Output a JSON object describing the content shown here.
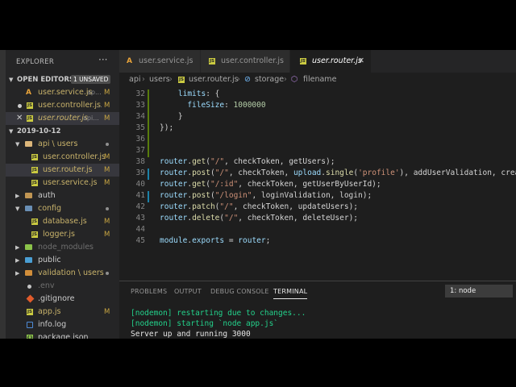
{
  "explorer": {
    "title": "EXPLORER",
    "more": "···",
    "open_editors": {
      "header": "OPEN EDITORS",
      "badge": "1 UNSAVED"
    },
    "open_files": [
      {
        "name": "user.service.js",
        "desc": "ap...",
        "status": "M"
      },
      {
        "name": "user.controller.js",
        "desc": "...",
        "status": "M"
      },
      {
        "name": "user.router.js",
        "desc": "api...",
        "status": "M",
        "close": "✕"
      }
    ],
    "project": {
      "name": "2019-10-12"
    },
    "tree": [
      {
        "name": "api \\ users"
      },
      {
        "name": "user.controller.js",
        "status": "M"
      },
      {
        "name": "user.router.js",
        "status": "M"
      },
      {
        "name": "user.service.js",
        "status": "M"
      },
      {
        "name": "auth"
      },
      {
        "name": "config"
      },
      {
        "name": "database.js",
        "status": "M"
      },
      {
        "name": "logger.js",
        "status": "M"
      },
      {
        "name": "node_modules"
      },
      {
        "name": "public"
      },
      {
        "name": "validation \\ users"
      },
      {
        "name": ".env"
      },
      {
        "name": ".gitignore"
      },
      {
        "name": "app.js",
        "status": "M"
      },
      {
        "name": "info.log"
      },
      {
        "name": "package.json"
      }
    ]
  },
  "tabs": [
    {
      "label": "user.service.js"
    },
    {
      "label": "user.controller.js"
    },
    {
      "label": "user.router.js",
      "close": "✕"
    }
  ],
  "breadcrumbs": [
    "api",
    "users",
    "user.router.js",
    "storage",
    "filename"
  ],
  "code": {
    "line_numbers": [
      "32",
      "33",
      "34",
      "35",
      "36",
      "37",
      "38",
      "39",
      "40",
      "41",
      "42",
      "43",
      "44",
      "45"
    ],
    "lines": [
      {
        "t": [
          [
            "kw",
            "    limits"
          ],
          [
            "pl",
            ": {"
          ]
        ]
      },
      {
        "t": [
          [
            "kw",
            "      fileSize"
          ],
          [
            "pl",
            ": "
          ],
          [
            "num",
            "1000000"
          ]
        ]
      },
      {
        "t": [
          [
            "pl",
            "    }"
          ]
        ]
      },
      {
        "t": [
          [
            "pl",
            "});"
          ]
        ]
      },
      {
        "t": []
      },
      {
        "t": []
      },
      {
        "t": [
          [
            "id",
            "router"
          ],
          [
            "pl",
            "."
          ],
          [
            "fn",
            "get"
          ],
          [
            "pl",
            "("
          ],
          [
            "str",
            "\"/\""
          ],
          [
            "pl",
            ", checkToken, getUsers);"
          ]
        ]
      },
      {
        "t": [
          [
            "id",
            "router"
          ],
          [
            "pl",
            "."
          ],
          [
            "fn",
            "post"
          ],
          [
            "pl",
            "("
          ],
          [
            "str",
            "\"/\""
          ],
          [
            "pl",
            ", checkToken, "
          ],
          [
            "id",
            "upload"
          ],
          [
            "pl",
            "."
          ],
          [
            "fn",
            "single"
          ],
          [
            "pl",
            "("
          ],
          [
            "str",
            "'profile'"
          ],
          [
            "pl",
            "), addUserValidation, crea"
          ]
        ]
      },
      {
        "t": [
          [
            "id",
            "router"
          ],
          [
            "pl",
            "."
          ],
          [
            "fn",
            "get"
          ],
          [
            "pl",
            "("
          ],
          [
            "str",
            "\"/:id\""
          ],
          [
            "pl",
            ", checkToken, getUserByUserId);"
          ]
        ]
      },
      {
        "t": [
          [
            "id",
            "router"
          ],
          [
            "pl",
            "."
          ],
          [
            "fn",
            "post"
          ],
          [
            "pl",
            "("
          ],
          [
            "str",
            "\"/login\""
          ],
          [
            "pl",
            ", loginValidation, login);"
          ]
        ]
      },
      {
        "t": [
          [
            "id",
            "router"
          ],
          [
            "pl",
            "."
          ],
          [
            "fn",
            "patch"
          ],
          [
            "pl",
            "("
          ],
          [
            "str",
            "\"/\""
          ],
          [
            "pl",
            ", checkToken, updateUsers);"
          ]
        ]
      },
      {
        "t": [
          [
            "id",
            "router"
          ],
          [
            "pl",
            "."
          ],
          [
            "fn",
            "delete"
          ],
          [
            "pl",
            "("
          ],
          [
            "str",
            "\"/\""
          ],
          [
            "pl",
            ", checkToken, deleteUser);"
          ]
        ]
      },
      {
        "t": []
      },
      {
        "t": [
          [
            "id",
            "module"
          ],
          [
            "pl",
            "."
          ],
          [
            "id",
            "exports"
          ],
          [
            "pl",
            " = "
          ],
          [
            "id",
            "router"
          ],
          [
            "pl",
            ";"
          ]
        ]
      }
    ]
  },
  "panel": {
    "tabs": [
      "PROBLEMS",
      "OUTPUT",
      "DEBUG CONSOLE",
      "TERMINAL"
    ],
    "terminal_select": "1: node",
    "terminal_lines": [
      "[nodemon] restarting due to changes...",
      "[nodemon] starting `node app.js`",
      "Server up and running 3000"
    ]
  }
}
